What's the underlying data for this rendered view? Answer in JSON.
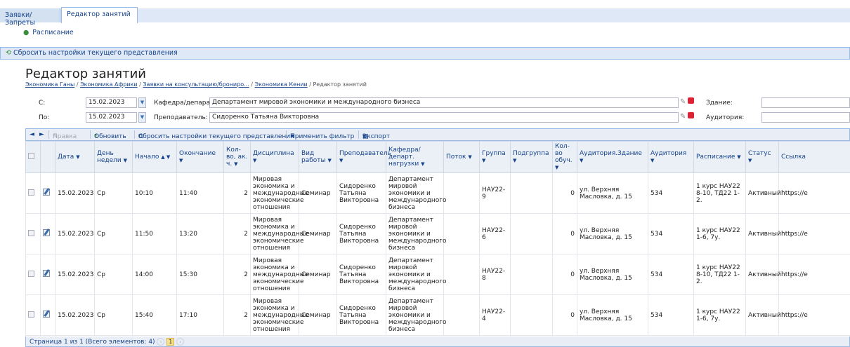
{
  "tabs": [
    {
      "label": "Заявки/Запреты"
    },
    {
      "label": "Редактор занятий"
    }
  ],
  "nav": {
    "schedule_link": "Расписание"
  },
  "reset_bar": {
    "label": "Сбросить настройки текущего представления"
  },
  "page": {
    "title": "Редактор занятий",
    "breadcrumbs": [
      "Экономика Ганы",
      "Экономика Африки",
      "Заявки на консультацию/брониро...",
      "Экономика Кении",
      "Редактор занятий"
    ]
  },
  "filters": {
    "from_label": "С:",
    "from_value": "15.02.2023",
    "to_label": "По:",
    "to_value": "15.02.2023",
    "dept_label": "Кафедра/депарат:",
    "dept_value": "Департамент мировой экономики и международного бизнеса",
    "teacher_label": "Преподаватель:",
    "teacher_value": "Сидоренко Татьяна Викторовна",
    "building_label": "Здание:",
    "building_value": "",
    "room_label": "Аудитория:",
    "room_value": ""
  },
  "toolbar": {
    "edit": "Правка",
    "refresh": "Обновить",
    "reset": "Сбросить настройки текущего представления",
    "apply_filter": "Применить фильтр",
    "export": "Экспорт"
  },
  "columns": [
    "Дата",
    "День недели",
    "Начало",
    "Окончание",
    "Кол-во, ак. ч.",
    "Дисциплина",
    "Вид работы",
    "Преподаватель",
    "Кафедра/ департ. нагрузки",
    "Поток",
    "Группа",
    "Подгруппа",
    "Кол-во обуч.",
    "Аудитория.Здание",
    "Аудитория",
    "Расписание",
    "Статус",
    "Ссылка"
  ],
  "rows": [
    {
      "date": "15.02.2023",
      "day": "Ср",
      "start": "10:10",
      "end": "11:40",
      "hours": "2",
      "discipline": "Мировая экономика и международные экономические отношения",
      "work": "Семинар",
      "teacher": "Сидоренко Татьяна Викторовна",
      "dept": "Департамент мировой экономики и международного бизнеса",
      "stream": "",
      "group": "НАУ22-9",
      "subgroup": "",
      "students": "0",
      "building": "ул. Верхняя Масловка, д. 15",
      "room": "534",
      "schedule": "1 курс НАУ22 8-10, ТД22 1-2.",
      "status": "Активный",
      "link": "https://e"
    },
    {
      "date": "15.02.2023",
      "day": "Ср",
      "start": "11:50",
      "end": "13:20",
      "hours": "2",
      "discipline": "Мировая экономика и международные экономические отношения",
      "work": "Семинар",
      "teacher": "Сидоренко Татьяна Викторовна",
      "dept": "Департамент мировой экономики и международного бизнеса",
      "stream": "",
      "group": "НАУ22-6",
      "subgroup": "",
      "students": "0",
      "building": "ул. Верхняя Масловка, д. 15",
      "room": "534",
      "schedule": "1 курс НАУ22 1-6, 7у.",
      "status": "Активный",
      "link": "https://e"
    },
    {
      "date": "15.02.2023",
      "day": "Ср",
      "start": "14:00",
      "end": "15:30",
      "hours": "2",
      "discipline": "Мировая экономика и международные экономические отношения",
      "work": "Семинар",
      "teacher": "Сидоренко Татьяна Викторовна",
      "dept": "Департамент мировой экономики и международного бизнеса",
      "stream": "",
      "group": "НАУ22-8",
      "subgroup": "",
      "students": "0",
      "building": "ул. Верхняя Масловка, д. 15",
      "room": "534",
      "schedule": "1 курс НАУ22 8-10, ТД22 1-2.",
      "status": "Активный",
      "link": "https://e"
    },
    {
      "date": "15.02.2023",
      "day": "Ср",
      "start": "15:40",
      "end": "17:10",
      "hours": "2",
      "discipline": "Мировая экономика и международные экономические отношения",
      "work": "Семинар",
      "teacher": "Сидоренко Татьяна Викторовна",
      "dept": "Департамент мировой экономики и международного бизнеса",
      "stream": "",
      "group": "НАУ22-4",
      "subgroup": "",
      "students": "0",
      "building": "ул. Верхняя Масловка, д. 15",
      "room": "534",
      "schedule": "1 курс НАУ22 1-6, 7у.",
      "status": "Активный",
      "link": "https://e"
    }
  ],
  "pager": {
    "summary": "Страница 1 из 1 (Всего элементов: 4)",
    "current_page": "1"
  }
}
